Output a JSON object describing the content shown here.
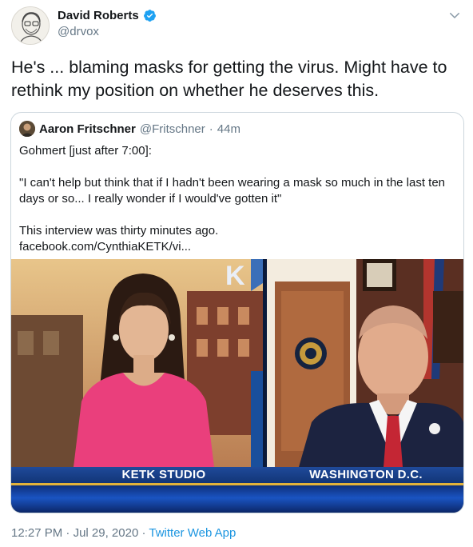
{
  "author": {
    "display_name": "David Roberts",
    "handle": "@drvox",
    "verified_icon": "verified-badge-icon"
  },
  "tweet": {
    "text": "He's ... blaming masks for getting the virus. Might have to rethink my position on whether he deserves this."
  },
  "quoted": {
    "display_name": "Aaron Fritschner",
    "handle": "@Fritschner",
    "separator": "·",
    "time": "44m",
    "lines": [
      "Gohmert [just after 7:00]:",
      "\"I can't help but think that if I hadn't been wearing a mask so much in the last ten days or so... I really wonder if I would've gotten it\"",
      "This interview was thirty minutes ago.",
      "facebook.com/CynthiaKETK/vi..."
    ],
    "media": {
      "left_label": "KETK STUDIO",
      "right_label": "WASHINGTON D.C.",
      "left_sign": "K"
    }
  },
  "footer": {
    "time": "12:27 PM",
    "date": "Jul 29, 2020",
    "separator": "·",
    "app": "Twitter Web App"
  },
  "colors": {
    "link": "#1b95e0",
    "muted": "#657786",
    "verified": "#1da1f2",
    "ketk_blue": "#1f4a9a",
    "gold": "#e2b23a"
  }
}
